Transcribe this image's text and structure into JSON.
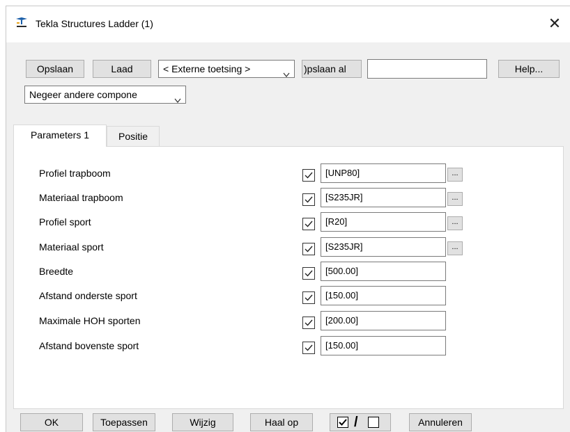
{
  "window": {
    "title": "Tekla Structures  Ladder (1)",
    "close_glyph": "✕",
    "app_icon": "tekla-icon"
  },
  "toolbar": {
    "save_label": "Opslaan",
    "load_label": "Laad",
    "preset_value": "< Externe toetsing >",
    "save_as_label": ")pslaan al",
    "save_as_name": "",
    "help_label": "Help...",
    "filter_value": "Negeer andere compone"
  },
  "tabs": [
    {
      "label": "Parameters 1",
      "active": true
    },
    {
      "label": "Positie",
      "active": false
    }
  ],
  "params": [
    {
      "label": "Profiel trapboom",
      "checked": true,
      "value": "[UNP80]",
      "has_browse": true
    },
    {
      "label": "Materiaal trapboom",
      "checked": true,
      "value": "[S235JR]",
      "has_browse": true
    },
    {
      "label": "Profiel sport",
      "checked": true,
      "value": "[R20]",
      "has_browse": true
    },
    {
      "label": "Materiaal sport",
      "checked": true,
      "value": "[S235JR]",
      "has_browse": true
    },
    {
      "label": "Breedte",
      "checked": true,
      "value": "[500.00]",
      "has_browse": false
    },
    {
      "label": "Afstand onderste sport",
      "checked": true,
      "value": "[150.00]",
      "has_browse": false
    },
    {
      "label": "Maximale HOH sporten",
      "checked": true,
      "value": "[200.00]",
      "has_browse": false
    },
    {
      "label": "Afstand bovenste sport",
      "checked": true,
      "value": "[150.00]",
      "has_browse": false
    }
  ],
  "browse_label": "...",
  "bottom": {
    "ok_label": "OK",
    "apply_label": "Toepassen",
    "modify_label": "Wijzig",
    "get_label": "Haal op",
    "toggle_sep": "/",
    "cancel_label": "Annuleren"
  },
  "colors": {
    "window_bg": "#f0f0f0",
    "button_bg": "#e1e1e1",
    "button_border": "#adadad",
    "panel_bg": "#ffffff"
  }
}
